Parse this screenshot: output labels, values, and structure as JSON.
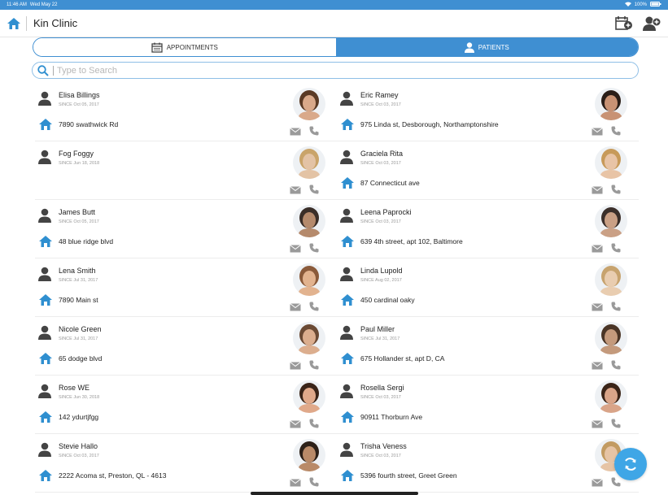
{
  "status_bar": {
    "time": "11:46 AM",
    "date": "Wed May 22",
    "battery": "100%"
  },
  "header": {
    "title": "Kin Clinic"
  },
  "tabs": [
    {
      "label": "APPOINTMENTS",
      "active": false,
      "icon": "calendar-icon"
    },
    {
      "label": "PATIENTS",
      "active": true,
      "icon": "person-icon"
    }
  ],
  "search": {
    "placeholder": "Type to Search",
    "value": ""
  },
  "colors": {
    "accent": "#3f8fd2",
    "house": "#2f8fd0",
    "icon_gray": "#777777"
  },
  "patients": [
    {
      "name": "Elisa Billings",
      "since": "SINCE Oct 05, 2017",
      "address": "7890 swathwick Rd",
      "avatar_tone": "#d9a98a",
      "hair": "#5a3a25"
    },
    {
      "name": "Eric  Ramey",
      "since": "SINCE Oct 03, 2017",
      "address": "975 Linda st, Desborough, Northamptonshire",
      "avatar_tone": "#c89274",
      "hair": "#2a1e18"
    },
    {
      "name": "Fog Foggy",
      "since": "SINCE Jun 18, 2018",
      "address": "",
      "avatar_tone": "#e3c3a5",
      "hair": "#c9a46a"
    },
    {
      "name": "Graciela Rita",
      "since": "SINCE Oct 03, 2017",
      "address": "87 Connecticut ave",
      "avatar_tone": "#e8c4a6",
      "hair": "#c79a5a"
    },
    {
      "name": "James Butt",
      "since": "SINCE Oct 05, 2017",
      "address": "48 blue ridge blvd",
      "avatar_tone": "#b58a6c",
      "hair": "#3a2e28"
    },
    {
      "name": "Leena Paprocki",
      "since": "SINCE Oct 03, 2017",
      "address": "639 4th street, apt 102, Baltimore",
      "avatar_tone": "#caa085",
      "hair": "#3b2f2a"
    },
    {
      "name": "Lena Smith",
      "since": "SINCE Jul 31, 2017",
      "address": "7890 Main st",
      "avatar_tone": "#e2b38f",
      "hair": "#8a5a3a"
    },
    {
      "name": "Linda Lupold",
      "since": "SINCE Aug 02, 2017",
      "address": "450 cardinal oaky",
      "avatar_tone": "#e9cdb0",
      "hair": "#c7a36e"
    },
    {
      "name": "Nicole Green",
      "since": "SINCE Jul 31, 2017",
      "address": "65 dodge blvd",
      "avatar_tone": "#dcae8e",
      "hair": "#6b4a34"
    },
    {
      "name": "Paul Miller",
      "since": "SINCE Jul 31, 2017",
      "address": "675 Hollander st, apt D, CA",
      "avatar_tone": "#c49a7c",
      "hair": "#4a3526"
    },
    {
      "name": "Rose WE",
      "since": "SINCE Jun 30, 2018",
      "address": "142 ydurtjfgg",
      "avatar_tone": "#e0a98a",
      "hair": "#3a2418"
    },
    {
      "name": "Rosella  Sergi",
      "since": "SINCE Oct 03, 2017",
      "address": "90911 Thorburn Ave",
      "avatar_tone": "#d9a488",
      "hair": "#3a2418"
    },
    {
      "name": "Stevie  Hallo",
      "since": "SINCE Oct 03, 2017",
      "address": "2222 Acoma st, Preston, QL - 4613",
      "avatar_tone": "#b98a68",
      "hair": "#2c2018"
    },
    {
      "name": "Trisha Veness",
      "since": "SINCE Oct 03, 2017",
      "address": "5396 fourth street, Greet Green",
      "avatar_tone": "#e6c4a5",
      "hair": "#c29b62"
    }
  ]
}
